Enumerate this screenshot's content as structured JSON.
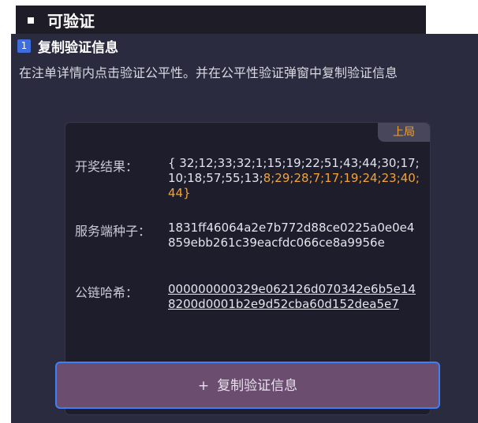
{
  "header": {
    "title": "可验证"
  },
  "step": {
    "number": "1",
    "title": "复制验证信息"
  },
  "description": "在注单详情内点击验证公平性。并在公平性验证弹窗中复制验证信息",
  "card": {
    "tag": "上局",
    "result": {
      "label": "开奖结果：",
      "value_normal": "{ 32;12;33;32;1;15;19;22;51;43;44;30;17;10;18;57;55;13;",
      "value_highlight": "8;29;28;7;17;19;24;23;40;44}"
    },
    "server_seed": {
      "label": "服务端种子：",
      "value": "1831ff46064a2e7b772d88ce0225a0e0e4859ebb261c39eacfdc066ce8a9956e"
    },
    "chain_hash": {
      "label": "公链哈希：",
      "value": "000000000329e062126d070342e6b5e148200d0001b2e9d52cba60d152dea5e7"
    }
  },
  "copy_button": {
    "icon": "+",
    "label": "复制验证信息"
  },
  "colors": {
    "accent": "#f2a33b",
    "highlight_border": "#3d7ff5",
    "panel_bg": "#2a2b3e"
  }
}
